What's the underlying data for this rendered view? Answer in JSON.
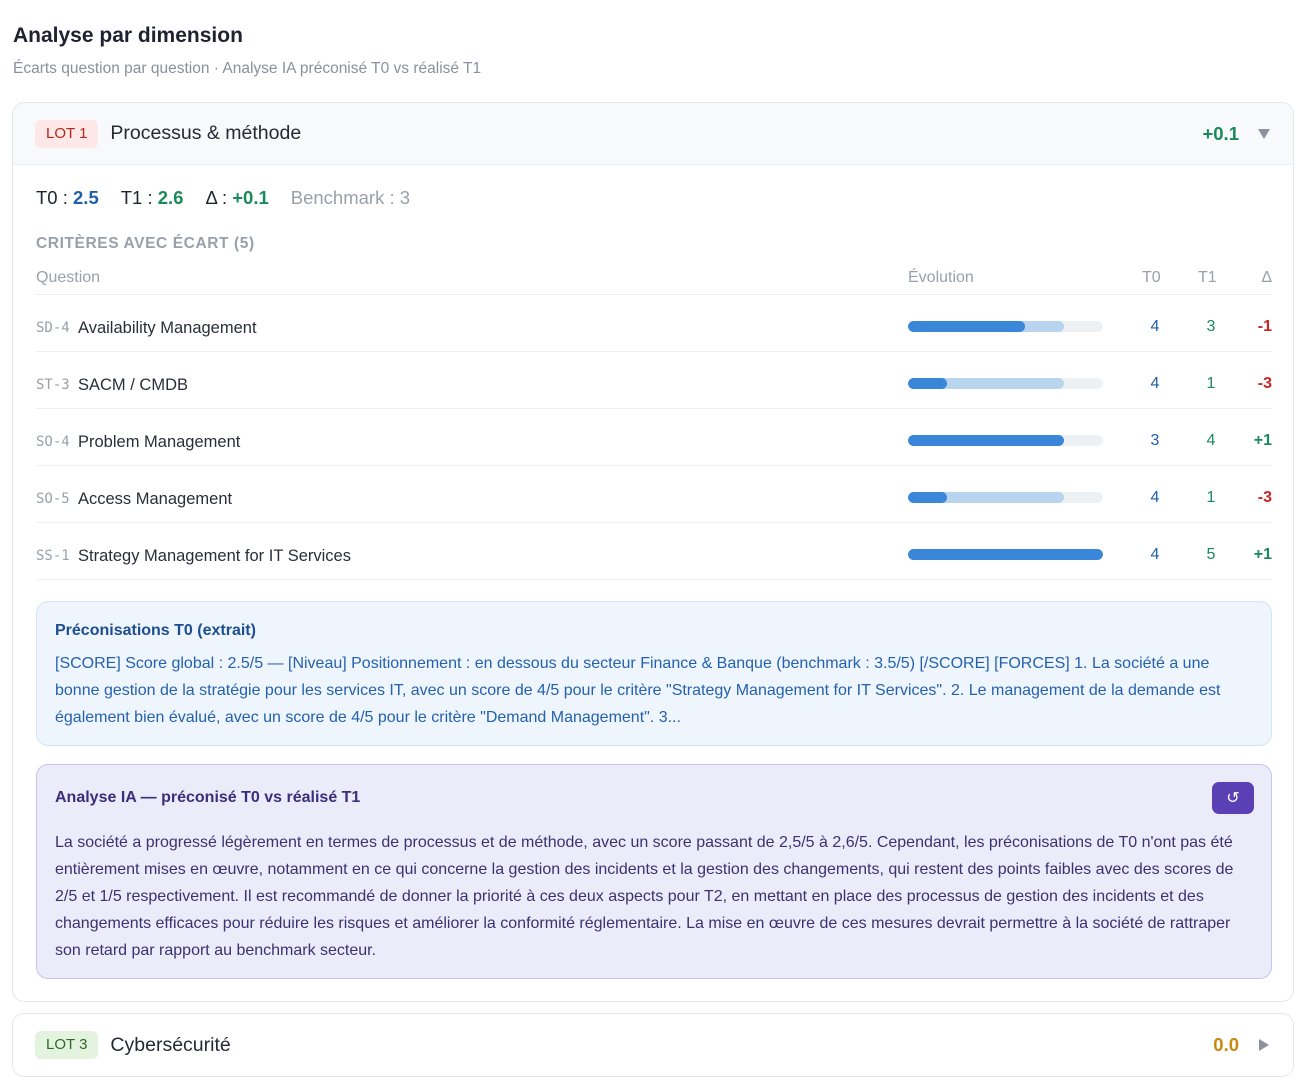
{
  "header": {
    "title": "Analyse par dimension",
    "subtitle": "Écarts question par question · Analyse IA préconisé T0 vs réalisé T1"
  },
  "lot1": {
    "badge": "LOT 1",
    "name": "Processus & méthode",
    "delta": "+0.1",
    "toggle_icon": "chevron-down-icon",
    "scores": {
      "t0_label": "T0 :",
      "t0_value": "2.5",
      "t1_label": "T1 :",
      "t1_value": "2.6",
      "delta_label": "Δ :",
      "delta_value": "+0.1",
      "benchmark": "Benchmark : 3"
    },
    "criteria_title": "CRITÈRES AVEC ÉCART (5)",
    "columns": {
      "question": "Question",
      "evolution": "Évolution",
      "t0": "T0",
      "t1": "T1",
      "delta": "Δ"
    },
    "rows": [
      {
        "code": "SD-4",
        "label": "Availability Management",
        "t0": "4",
        "t1": "3",
        "delta": "-1",
        "t0_frac": 0.8,
        "t1_frac": 0.6
      },
      {
        "code": "ST-3",
        "label": "SACM / CMDB",
        "t0": "4",
        "t1": "1",
        "delta": "-3",
        "t0_frac": 0.8,
        "t1_frac": 0.2
      },
      {
        "code": "SO-4",
        "label": "Problem Management",
        "t0": "3",
        "t1": "4",
        "delta": "+1",
        "t0_frac": 0.6,
        "t1_frac": 0.8
      },
      {
        "code": "SO-5",
        "label": "Access Management",
        "t0": "4",
        "t1": "1",
        "delta": "-3",
        "t0_frac": 0.8,
        "t1_frac": 0.2
      },
      {
        "code": "SS-1",
        "label": "Strategy Management for IT Services",
        "t0": "4",
        "t1": "5",
        "delta": "+1",
        "t0_frac": 0.8,
        "t1_frac": 1.0
      }
    ],
    "recommendations": {
      "title": "Préconisations T0 (extrait)",
      "text": "[SCORE] Score global : 2.5/5 — [Niveau] Positionnement : en dessous du secteur Finance & Banque (benchmark : 3.5/5) [/SCORE] [FORCES] 1. La société a une bonne gestion de la stratégie pour les services IT, avec un score de 4/5 pour le critère \"Strategy Management for IT Services\". 2. Le management de la demande est également bien évalué, avec un score de 4/5 pour le critère \"Demand Management\". 3..."
    },
    "ai_analysis": {
      "title": "Analyse IA — préconisé T0 vs réalisé T1",
      "refresh_icon": "refresh-icon",
      "text": "La société a progressé légèrement en termes de processus et de méthode, avec un score passant de 2,5/5 à 2,6/5. Cependant, les préconisations de T0 n'ont pas été entièrement mises en œuvre, notamment en ce qui concerne la gestion des incidents et la gestion des changements, qui restent des points faibles avec des scores de 2/5 et 1/5 respectivement. Il est recommandé de donner la priorité à ces deux aspects pour T2, en mettant en place des processus de gestion des incidents et des changements efficaces pour réduire les risques et améliorer la conformité réglementaire. La mise en œuvre de ces mesures devrait permettre à la société de rattraper son retard par rapport au benchmark secteur."
    }
  },
  "lot3": {
    "badge": "LOT 3",
    "name": "Cybersécurité",
    "delta": "0.0",
    "toggle_icon": "chevron-right-icon"
  },
  "colors": {
    "t0_blue": "#1f5fa8",
    "t1_green": "#1b8a5a",
    "negative_red": "#c62828",
    "neutral_orange": "#c98a12",
    "bar_t1": "#3a86d8",
    "bar_t0": "#b8d4ef",
    "ai_accent": "#5b3fb5"
  }
}
